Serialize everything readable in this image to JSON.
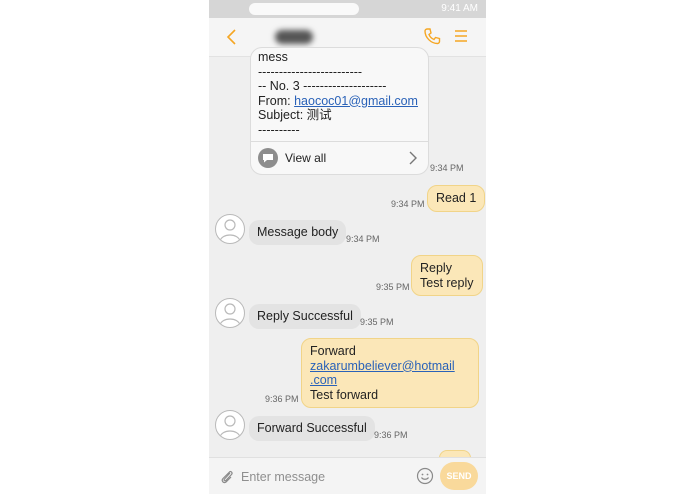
{
  "app": {
    "status_time": "9:41 AM",
    "appbar": {
      "back_icon": "chevron-left-icon",
      "call_icon": "phone-icon",
      "menu_icon": "menu-icon"
    },
    "accent_color": "#f5a623"
  },
  "card": {
    "partial_line": "mess",
    "separator": "-------------------------",
    "number_line": "-- No. 3 --------------------",
    "from_label": "From: ",
    "from_email": "haococ01@gmail.com",
    "subject_line": "Subject: 测试",
    "short_sep": "----------",
    "view_all": "View all",
    "time": "9:34 PM"
  },
  "messages": [
    {
      "dir": "out",
      "text": "Read 1",
      "time": "9:34 PM"
    },
    {
      "dir": "in",
      "text": "Message body",
      "time": "9:34 PM"
    },
    {
      "dir": "out",
      "line1": "Reply",
      "line2": "Test reply",
      "time": "9:35 PM"
    },
    {
      "dir": "in",
      "text": "Reply Successful",
      "time": "9:35 PM"
    },
    {
      "dir": "out",
      "line1": "Forward",
      "link1": "zakarumbeliever@hotmail",
      "link2": ".com",
      "line4": "Test forward",
      "time": "9:36 PM"
    },
    {
      "dir": "in",
      "text": "Forward Successful",
      "time": "9:36 PM"
    }
  ],
  "composer": {
    "placeholder": "Enter message",
    "send_label": "SEND"
  }
}
